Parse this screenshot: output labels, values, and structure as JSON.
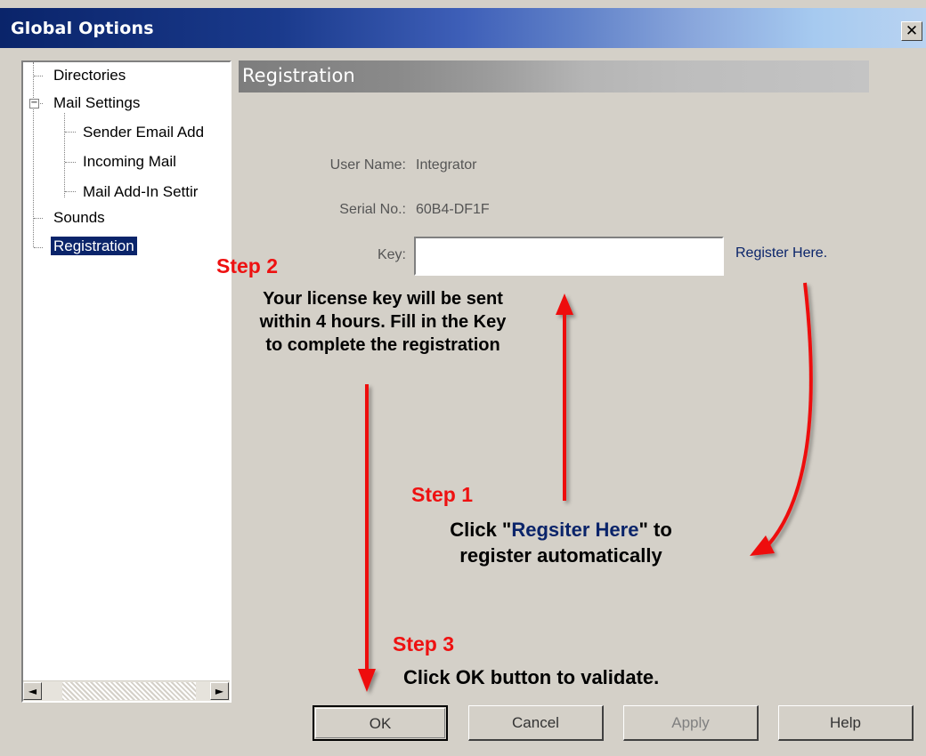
{
  "window": {
    "title": "Global Options",
    "close_glyph": "✕"
  },
  "tree": {
    "items": [
      {
        "label": "Directories"
      },
      {
        "label": "Mail Settings",
        "expander": "−"
      },
      {
        "label": "Sender Email Add"
      },
      {
        "label": "Incoming Mail"
      },
      {
        "label": "Mail Add-In Settir"
      },
      {
        "label": "Sounds"
      },
      {
        "label": "Registration",
        "selected": true
      }
    ],
    "scroll_left": "◄",
    "scroll_right": "►"
  },
  "section": {
    "title": "Registration"
  },
  "form": {
    "user_name_label": "User Name:",
    "user_name_value": "Integrator",
    "serial_label": "Serial No.:",
    "serial_value": "60B4-DF1F",
    "key_label": "Key:",
    "key_value": "",
    "register_link": "Register Here."
  },
  "annotations": {
    "step1_title": "Step 1",
    "step1_text_a": "Click \"",
    "step1_text_hl": "Regsiter Here",
    "step1_text_b": "\" to",
    "step1_text_c": "register automatically",
    "step2_title": "Step 2",
    "step2_line1": "Your license key will be sent",
    "step2_line2": "within 4 hours. Fill in the Key",
    "step2_line3": "to complete the registration",
    "step3_title": "Step 3",
    "step3_text": "Click OK button to validate.",
    "arrow_color": "#ee1111"
  },
  "buttons": {
    "ok": "OK",
    "cancel": "Cancel",
    "apply": "Apply",
    "help": "Help"
  }
}
